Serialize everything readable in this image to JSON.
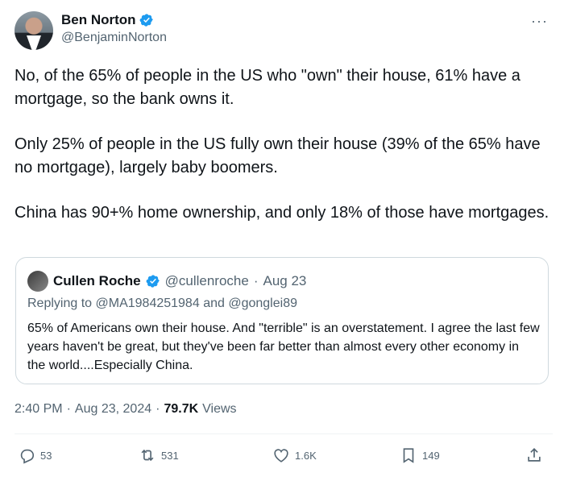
{
  "author": {
    "display_name": "Ben Norton",
    "handle": "@BenjaminNorton"
  },
  "more_icon": "···",
  "tweet": {
    "paragraphs": [
      "No, of the 65% of people in the US who \"own\" their house, 61% have a mortgage, so the bank owns it.",
      "Only 25% of people in the US fully own their house (39% of the 65% have no mortgage), largely baby boomers.",
      "China has 90+% home ownership, and only 18% of those have mortgages."
    ]
  },
  "quote": {
    "display_name": "Cullen Roche",
    "handle": "@cullenroche",
    "separator": "·",
    "date": "Aug 23",
    "replying_prefix": "Replying to",
    "reply_to_1": "@MA1984251984",
    "reply_and": "and",
    "reply_to_2": "@gonglei89",
    "text": "65% of Americans own their house. And \"terrible\" is an overstatement. I agree the last few years haven't be great, but they've been far better than almost every other economy in the world....Especially China."
  },
  "meta": {
    "time": "2:40 PM",
    "sep1": "·",
    "date": "Aug 23, 2024",
    "sep2": "·",
    "views_count": "79.7K",
    "views_label": "Views"
  },
  "actions": {
    "reply_count": "53",
    "retweet_count": "531",
    "like_count": "1.6K",
    "bookmark_count": "149"
  },
  "colors": {
    "verified_blue": "#1d9bf0",
    "secondary_text": "#536471",
    "primary_text": "#0f1419",
    "border": "#cfd9de"
  },
  "icons": [
    "verified-badge-icon",
    "more-icon",
    "reply-icon",
    "retweet-icon",
    "like-icon",
    "bookmark-icon",
    "share-icon"
  ]
}
